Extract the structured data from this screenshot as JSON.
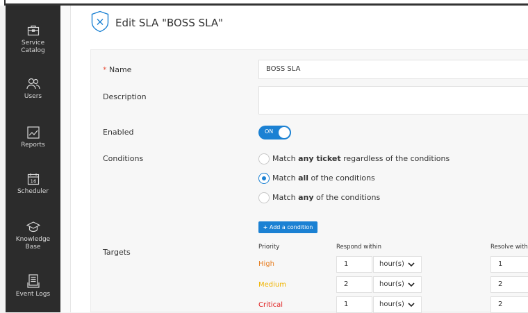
{
  "sidebar": {
    "items": [
      {
        "label": "Service\nCatalog",
        "icon": "briefcase-icon"
      },
      {
        "label": "Users",
        "icon": "users-icon"
      },
      {
        "label": "Reports",
        "icon": "chart-icon"
      },
      {
        "label": "Scheduler",
        "icon": "calendar-icon"
      },
      {
        "label": "Knowledge\nBase",
        "icon": "graduation-cap-icon"
      },
      {
        "label": "Event Logs",
        "icon": "document-icon"
      }
    ],
    "calendar_day": "16"
  },
  "header": {
    "title": "Edit SLA \"BOSS SLA\"",
    "icon": "shield-close-icon"
  },
  "form": {
    "name_required_mark": "*",
    "name_label": "Name",
    "name_value": "BOSS SLA",
    "description_label": "Description",
    "description_value": "",
    "enabled_label": "Enabled",
    "enabled_state": "ON",
    "conditions_label": "Conditions",
    "condition_options": [
      {
        "pre": "Match ",
        "bold": "any ticket",
        "post": " regardless of the conditions",
        "checked": false
      },
      {
        "pre": "Match ",
        "bold": "all",
        "post": " of the conditions",
        "checked": true
      },
      {
        "pre": "Match ",
        "bold": "any",
        "post": " of the conditions",
        "checked": false
      }
    ],
    "add_condition_label": "Add a condition",
    "targets_label": "Targets",
    "columns": {
      "priority": "Priority",
      "respond": "Respond within",
      "resolve": "Resolve with"
    },
    "targets": [
      {
        "priority": "High",
        "color": "#e67e22",
        "respond_value": "1",
        "respond_unit": "hour(s)",
        "resolve_value": "1"
      },
      {
        "priority": "Medium",
        "color": "#f0b400",
        "respond_value": "2",
        "respond_unit": "hour(s)",
        "resolve_value": "2"
      },
      {
        "priority": "Critical",
        "color": "#e02020",
        "respond_value": "1",
        "respond_unit": "hour(s)",
        "resolve_value": "2"
      }
    ]
  },
  "colors": {
    "accent": "#1b81d3",
    "sidebar": "#2c2c2c"
  }
}
